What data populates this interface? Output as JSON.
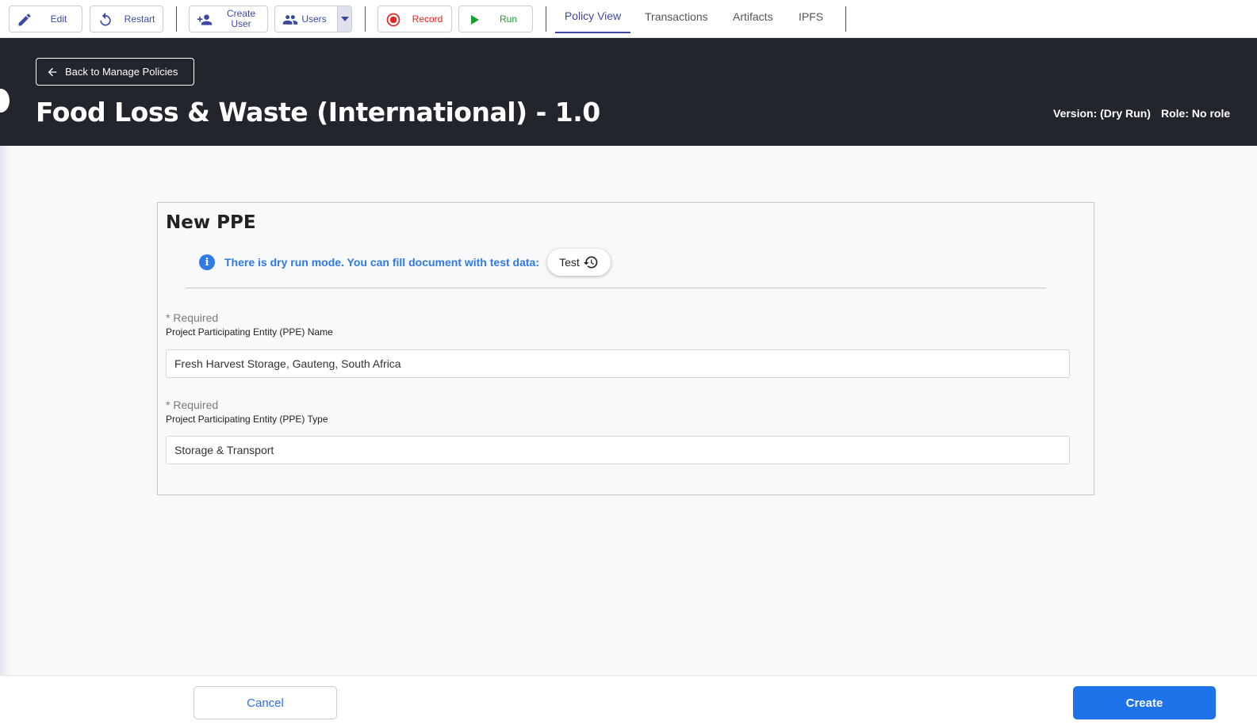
{
  "toolbar": {
    "edit_label": "Edit",
    "restart_label": "Restart",
    "create_user_label_1": "Create",
    "create_user_label_2": "User",
    "users_label": "Users",
    "record_label": "Record",
    "run_label": "Run",
    "tabs": [
      {
        "label": "Policy View",
        "active": true
      },
      {
        "label": "Transactions",
        "active": false
      },
      {
        "label": "Artifacts",
        "active": false
      },
      {
        "label": "IPFS",
        "active": false
      }
    ],
    "icons": [
      "pencil-icon",
      "restart-icon",
      "add-user-icon",
      "users-icon",
      "chevron-down-icon",
      "record-icon",
      "play-icon"
    ]
  },
  "header": {
    "back_label": "Back to Manage Policies",
    "title": "Food Loss & Waste (International) - 1.0",
    "version_label": "Version: (Dry Run)",
    "role_label": "Role: No role"
  },
  "form": {
    "title": "New PPE",
    "dry_run_notice": "There is dry run mode. You can fill document with test data:",
    "test_button_label": "Test",
    "fields": [
      {
        "required_label": "* Required",
        "label": "Project Participating Entity (PPE) Name",
        "value": "Fresh Harvest Storage, Gauteng, South Africa"
      },
      {
        "required_label": "* Required",
        "label": "Project Participating Entity (PPE) Type",
        "value": "Storage & Transport"
      }
    ]
  },
  "footer": {
    "cancel_label": "Cancel",
    "create_label": "Create"
  },
  "colors": {
    "toolbar_accent": "#3b4aa0",
    "record_red": "#e8211a",
    "run_green": "#1a9e2e",
    "header_bg": "#22252c",
    "primary_blue": "#1f73e8",
    "info_blue": "#2f7ae5"
  }
}
